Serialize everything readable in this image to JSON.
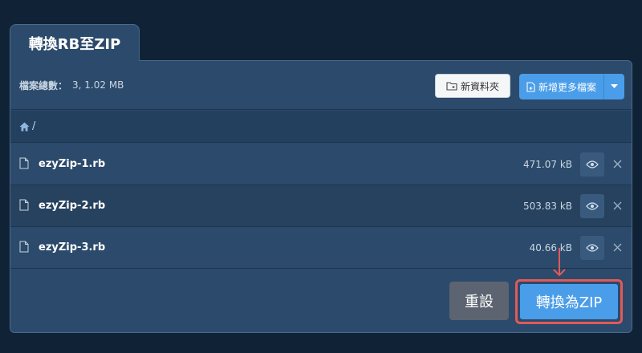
{
  "tab": {
    "title": "轉換RB至ZIP"
  },
  "summary": {
    "label": "檔案總數：",
    "value": "3, 1.02 MB"
  },
  "toolbar": {
    "new_folder_label": "新資料夾",
    "add_files_label": "新增更多檔案"
  },
  "breadcrumb": {
    "separator": "/"
  },
  "files": [
    {
      "name": "ezyZip-1.rb",
      "size": "471.07 kB"
    },
    {
      "name": "ezyZip-2.rb",
      "size": "503.83 kB"
    },
    {
      "name": "ezyZip-3.rb",
      "size": "40.66 kB"
    }
  ],
  "footer": {
    "reset_label": "重設",
    "convert_label": "轉換為ZIP"
  },
  "colors": {
    "background": "#0f2236",
    "panel": "#2c4a6b",
    "accent": "#4a9de8",
    "highlight": "#e05a5a"
  }
}
